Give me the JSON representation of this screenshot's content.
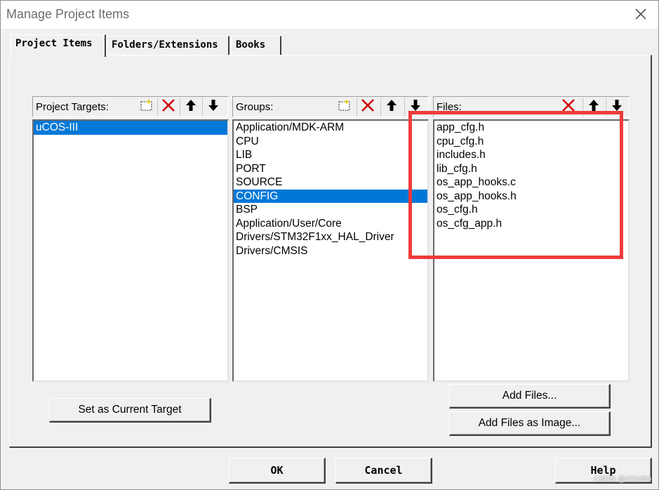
{
  "window": {
    "title": "Manage Project Items",
    "close_icon": "close-icon"
  },
  "tabs": [
    {
      "label": "Project Items",
      "active": true
    },
    {
      "label": "Folders/Extensions",
      "active": false
    },
    {
      "label": "Books",
      "active": false
    }
  ],
  "targets": {
    "label": "Project Targets:",
    "toolbar": [
      "new-item-icon",
      "delete-icon",
      "move-up-icon",
      "move-down-icon"
    ],
    "items": [
      "uCOS-III"
    ],
    "selected": "uCOS-III"
  },
  "groups": {
    "label": "Groups:",
    "toolbar": [
      "new-item-icon",
      "delete-icon",
      "move-up-icon",
      "move-down-icon"
    ],
    "items": [
      "Application/MDK-ARM",
      "CPU",
      "LIB",
      "PORT",
      "SOURCE",
      "CONFIG",
      "BSP",
      "Application/User/Core",
      "Drivers/STM32F1xx_HAL_Driver",
      "Drivers/CMSIS"
    ],
    "selected": "CONFIG"
  },
  "files": {
    "label": "Files:",
    "toolbar": [
      "delete-icon",
      "move-up-icon",
      "move-down-icon"
    ],
    "items": [
      "app_cfg.h",
      "cpu_cfg.h",
      "includes.h",
      "lib_cfg.h",
      "os_app_hooks.c",
      "os_app_hooks.h",
      "os_cfg.h",
      "os_cfg_app.h"
    ]
  },
  "buttons": {
    "set_current_target": "Set as Current Target",
    "add_files": "Add Files...",
    "add_files_as_image": "Add Files as Image...",
    "ok": "OK",
    "cancel": "Cancel",
    "help": "Help"
  },
  "annotation_color": "#ef3b3b",
  "selection_color": "#0078d7",
  "watermark": "CSDN @474459"
}
